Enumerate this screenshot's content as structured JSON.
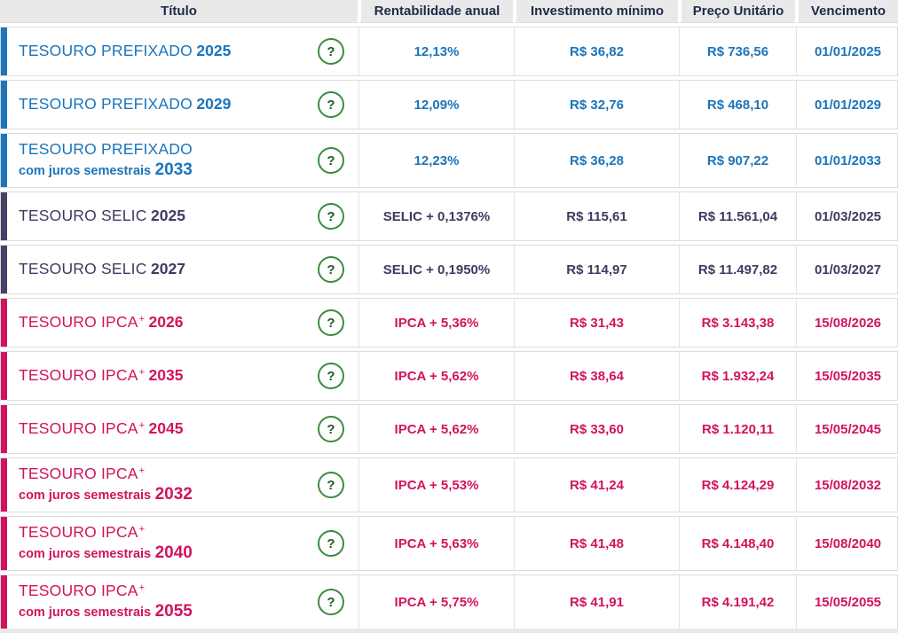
{
  "table": {
    "columns": [
      {
        "label": "Título"
      },
      {
        "label": "Rentabilidade anual"
      },
      {
        "label": "Investimento mínimo"
      },
      {
        "label": "Preço Unitário"
      },
      {
        "label": "Vencimento"
      }
    ],
    "help_icon": "?",
    "rows": [
      {
        "name": "TESOURO PREFIXADO",
        "sup": "",
        "subtitle": "",
        "year": "2025",
        "theme": "blue",
        "rate": "12,13%",
        "min_investment": "R$ 36,82",
        "unit_price": "R$ 736,56",
        "maturity": "01/01/2025"
      },
      {
        "name": "TESOURO PREFIXADO",
        "sup": "",
        "subtitle": "",
        "year": "2029",
        "theme": "blue",
        "rate": "12,09%",
        "min_investment": "R$ 32,76",
        "unit_price": "R$ 468,10",
        "maturity": "01/01/2029"
      },
      {
        "name": "TESOURO PREFIXADO",
        "sup": "",
        "subtitle": "com juros semestrais",
        "year": "2033",
        "theme": "blue",
        "rate": "12,23%",
        "min_investment": "R$ 36,28",
        "unit_price": "R$ 907,22",
        "maturity": "01/01/2033"
      },
      {
        "name": "TESOURO SELIC",
        "sup": "",
        "subtitle": "",
        "year": "2025",
        "theme": "purple",
        "rate": "SELIC + 0,1376%",
        "min_investment": "R$ 115,61",
        "unit_price": "R$ 11.561,04",
        "maturity": "01/03/2025"
      },
      {
        "name": "TESOURO SELIC",
        "sup": "",
        "subtitle": "",
        "year": "2027",
        "theme": "purple",
        "rate": "SELIC + 0,1950%",
        "min_investment": "R$ 114,97",
        "unit_price": "R$ 11.497,82",
        "maturity": "01/03/2027"
      },
      {
        "name": "TESOURO IPCA",
        "sup": "+",
        "subtitle": "",
        "year": "2026",
        "theme": "pink",
        "rate": "IPCA + 5,36%",
        "min_investment": "R$ 31,43",
        "unit_price": "R$ 3.143,38",
        "maturity": "15/08/2026"
      },
      {
        "name": "TESOURO IPCA",
        "sup": "+",
        "subtitle": "",
        "year": "2035",
        "theme": "pink",
        "rate": "IPCA + 5,62%",
        "min_investment": "R$ 38,64",
        "unit_price": "R$ 1.932,24",
        "maturity": "15/05/2035"
      },
      {
        "name": "TESOURO IPCA",
        "sup": "+",
        "subtitle": "",
        "year": "2045",
        "theme": "pink",
        "rate": "IPCA + 5,62%",
        "min_investment": "R$ 33,60",
        "unit_price": "R$ 1.120,11",
        "maturity": "15/05/2045"
      },
      {
        "name": "TESOURO IPCA",
        "sup": "+",
        "subtitle": "com juros semestrais",
        "year": "2032",
        "theme": "pink",
        "rate": "IPCA + 5,53%",
        "min_investment": "R$ 41,24",
        "unit_price": "R$ 4.124,29",
        "maturity": "15/08/2032"
      },
      {
        "name": "TESOURO IPCA",
        "sup": "+",
        "subtitle": "com juros semestrais",
        "year": "2040",
        "theme": "pink",
        "rate": "IPCA + 5,63%",
        "min_investment": "R$ 41,48",
        "unit_price": "R$ 4.148,40",
        "maturity": "15/08/2040"
      },
      {
        "name": "TESOURO IPCA",
        "sup": "+",
        "subtitle": "com juros semestrais",
        "year": "2055",
        "theme": "pink",
        "rate": "IPCA + 5,75%",
        "min_investment": "R$ 41,91",
        "unit_price": "R$ 4.191,42",
        "maturity": "15/05/2055"
      }
    ]
  },
  "colors": {
    "prefixado_blue": "#1b75bb",
    "selic_purple": "#474064",
    "ipca_pink": "#d1135e",
    "header_bg": "#e9e9e9",
    "header_text": "#1d2b49",
    "help_circle_green": "#3d8b40",
    "help_mark_green": "#1d5b20",
    "row_border": "#dcdcdc"
  }
}
